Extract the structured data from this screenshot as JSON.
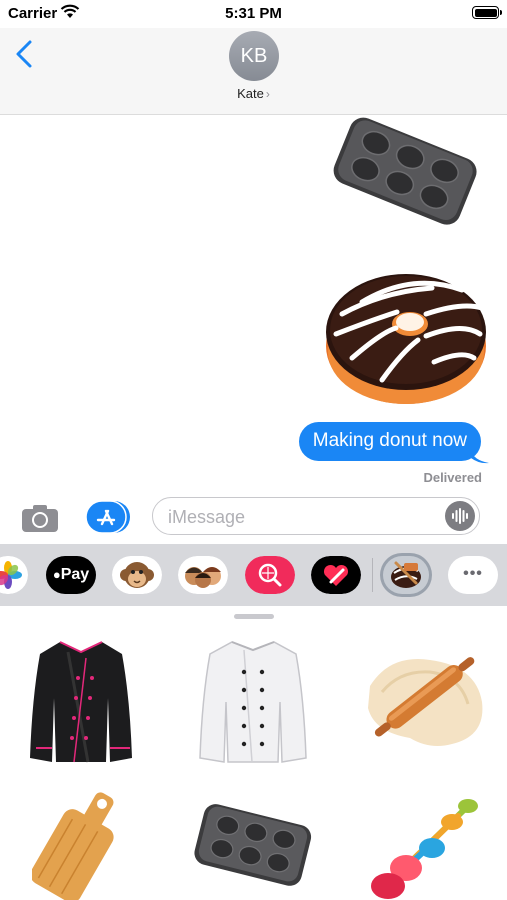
{
  "status_bar": {
    "carrier": "Carrier",
    "time": "5:31 PM"
  },
  "header": {
    "avatar_initials": "KB",
    "contact_name": "Kate",
    "contact_chevron": "›"
  },
  "thread": {
    "stickers": [
      "muffin-tin-sticker",
      "donut-sticker"
    ],
    "message_text": "Making donut now",
    "status": "Delivered"
  },
  "input": {
    "placeholder": "iMessage"
  },
  "app_drawer": {
    "apple_pay_label": "Pay",
    "more_label": "•••"
  },
  "sticker_panel": {
    "items": [
      "black-chef-jacket-sticker",
      "white-chef-jacket-sticker",
      "rolling-pin-dough-sticker",
      "cutting-board-sticker",
      "muffin-tin-sticker",
      "measuring-spoons-sticker"
    ]
  },
  "colors": {
    "accent": "#1a86f5",
    "drawer": "#d7d8dc",
    "header": "#f6f6f6"
  }
}
